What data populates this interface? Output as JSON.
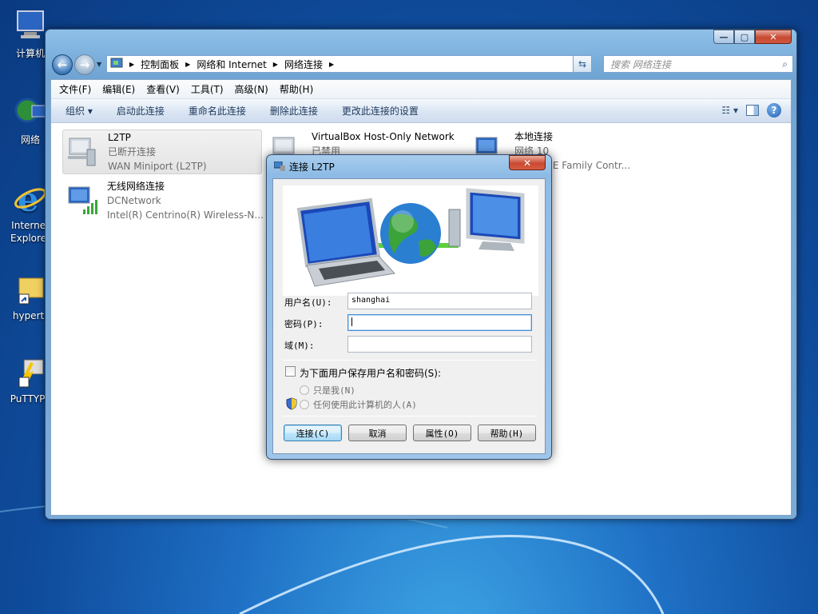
{
  "desktop": {
    "icons": [
      {
        "label": "计算机"
      },
      {
        "label": "网络"
      },
      {
        "label": "Internet Explorer"
      },
      {
        "label": "hypertr"
      },
      {
        "label": "PuTTYPo"
      }
    ]
  },
  "window": {
    "address": {
      "segments": [
        "控制面板",
        "网络和 Internet",
        "网络连接"
      ]
    },
    "search_placeholder": "搜索 网络连接",
    "menu": [
      "文件(F)",
      "编辑(E)",
      "查看(V)",
      "工具(T)",
      "高级(N)",
      "帮助(H)"
    ],
    "commands": [
      "组织 ▾",
      "启动此连接",
      "重命名此连接",
      "删除此连接",
      "更改此连接的设置"
    ],
    "connections": [
      {
        "name": "L2TP",
        "status": "已断开连接",
        "device": "WAN Miniport (L2TP)"
      },
      {
        "name": "VirtualBox Host-Only Network",
        "status": "已禁用",
        "device": ""
      },
      {
        "name": "本地连接",
        "status": "网络 10",
        "device": "PCIe GBE Family Contr..."
      },
      {
        "name": "无线网络连接",
        "status": "DCNetwork",
        "device": "Intel(R) Centrino(R) Wireless-N..."
      }
    ]
  },
  "dialog": {
    "title": "连接 L2TP",
    "username_label": "用户名(U):",
    "username_value": "shanghai",
    "password_label": "密码(P):",
    "password_value": "",
    "domain_label": "域(M):",
    "domain_value": "",
    "save_label": "为下面用户保存用户名和密码(S):",
    "radio_me": "只是我(N)",
    "radio_anyone": "任何使用此计算机的人(A)",
    "buttons": {
      "connect": "连接(C)",
      "cancel": "取消",
      "properties": "属性(O)",
      "help": "帮助(H)"
    }
  },
  "colors": {
    "accent": "#3c7fb1",
    "close": "#c94a31"
  }
}
